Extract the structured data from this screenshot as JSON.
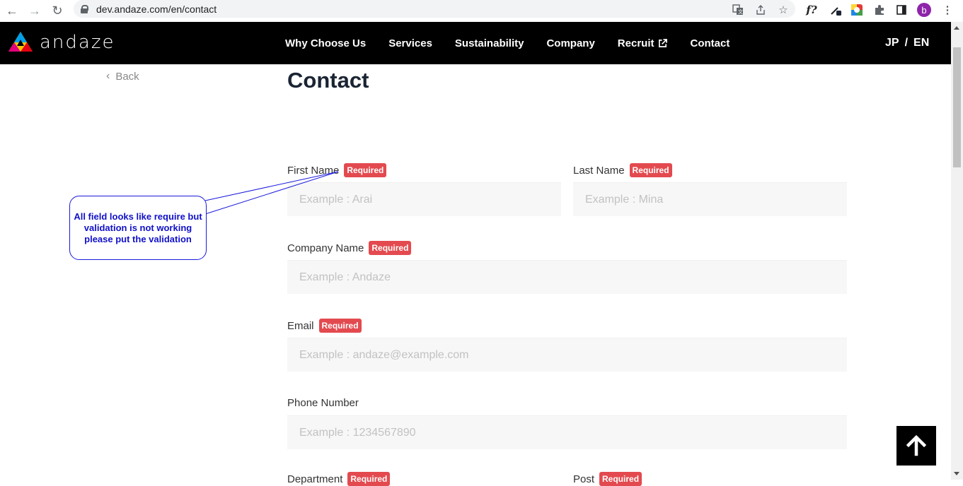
{
  "browser": {
    "url": "dev.andaze.com/en/contact",
    "profile_initial": "b",
    "font_ext_label": "f?"
  },
  "header": {
    "logo_text": "andaze",
    "menu": [
      {
        "label": "Why Choose Us"
      },
      {
        "label": "Services"
      },
      {
        "label": "Sustainability"
      },
      {
        "label": "Company"
      },
      {
        "label": "Recruit"
      },
      {
        "label": "Contact"
      }
    ],
    "lang_jp": "JP",
    "lang_sep": "/",
    "lang_en": "EN"
  },
  "page": {
    "back_label": "Back",
    "title": "Contact"
  },
  "form": {
    "required_badge": "Required",
    "first_name": {
      "label": "First Name",
      "placeholder": "Example : Arai"
    },
    "last_name": {
      "label": "Last Name",
      "placeholder": "Example : Mina"
    },
    "company_name": {
      "label": "Company Name",
      "placeholder": "Example : Andaze"
    },
    "email": {
      "label": "Email",
      "placeholder": "Example : andaze@example.com"
    },
    "phone": {
      "label": "Phone Number",
      "placeholder": "Example : 1234567890"
    },
    "department": {
      "label": "Department"
    },
    "post": {
      "label": "Post"
    }
  },
  "annotation": {
    "text": "All field looks like require but validation is not working please put the validation"
  },
  "colors": {
    "header_bg": "#000000",
    "required_badge": "#e34a4f",
    "annotation": "#1010c8"
  }
}
